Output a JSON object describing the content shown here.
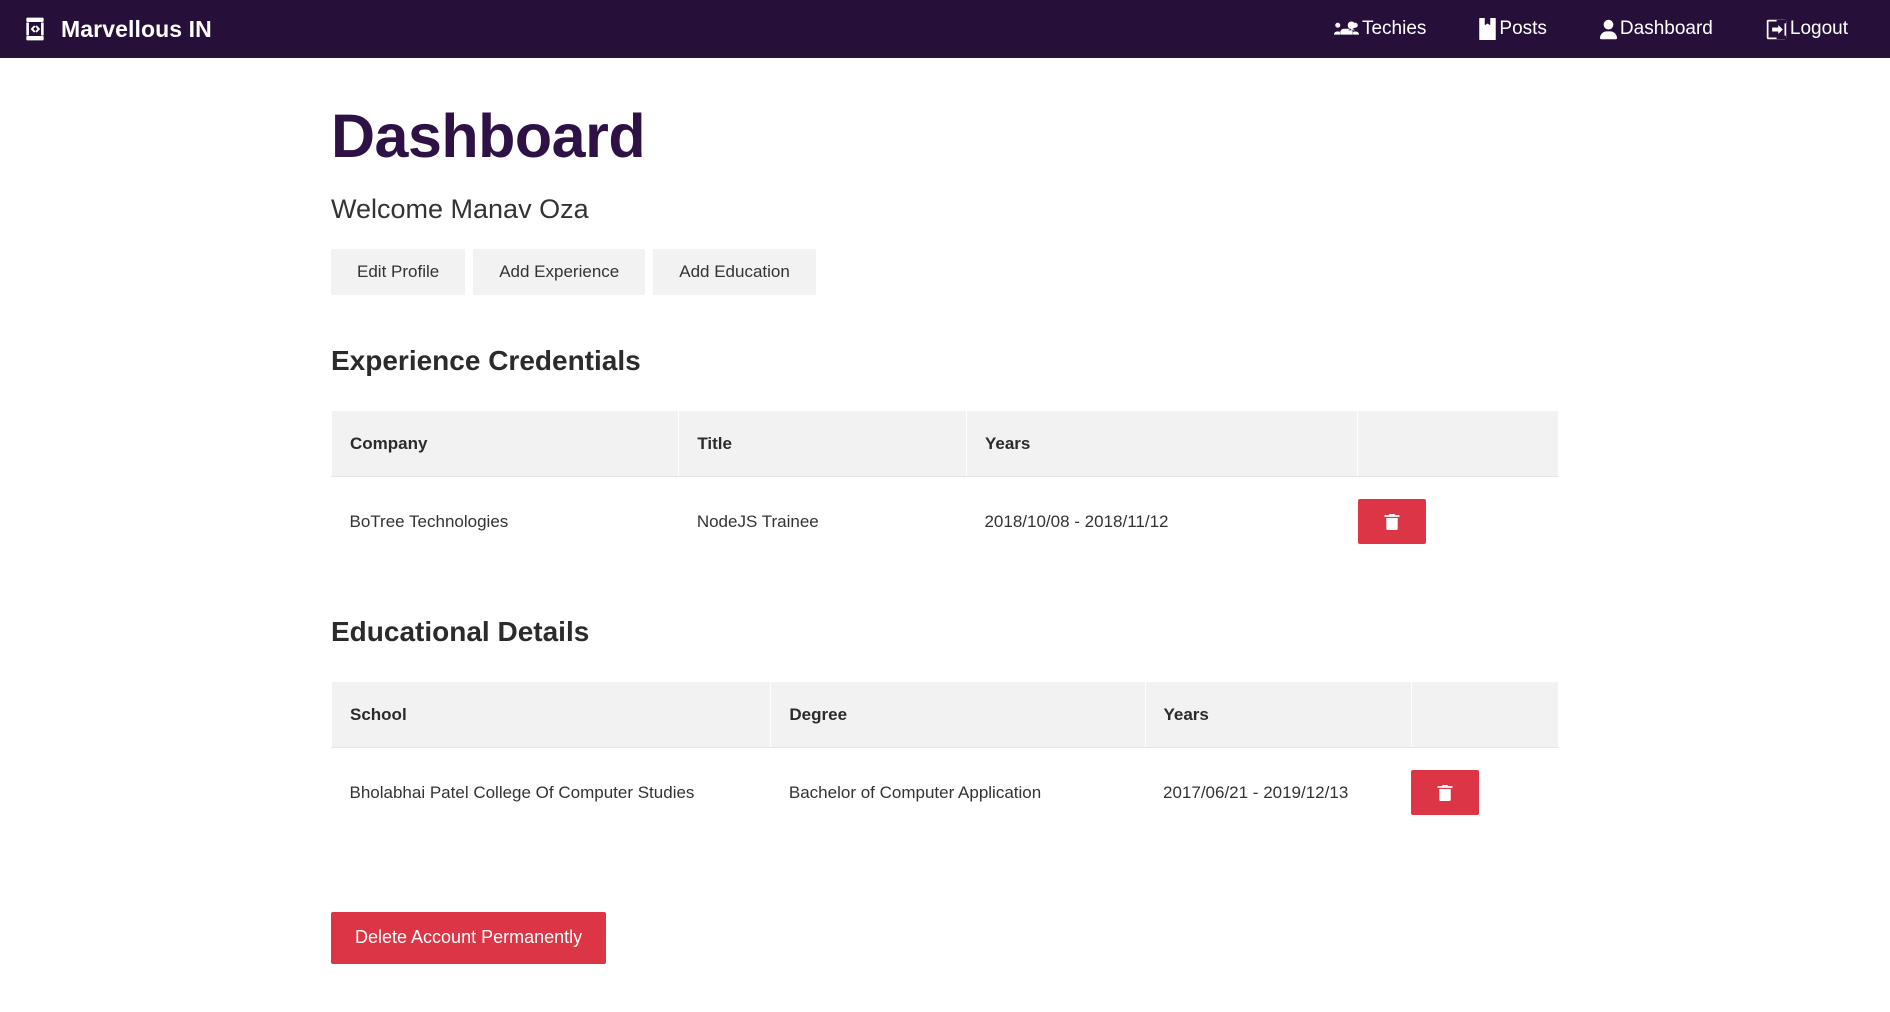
{
  "navbar": {
    "brand": {
      "label": "Marvellous IN",
      "icon": "code-laptop-icon"
    },
    "links": [
      {
        "label": "Techies",
        "icon": "users-icon"
      },
      {
        "label": "Posts",
        "icon": "book-bookmark-icon"
      },
      {
        "label": "Dashboard",
        "icon": "user-icon"
      },
      {
        "label": "Logout",
        "icon": "sign-out-icon"
      }
    ],
    "background": "#26103a",
    "text_color": "#ffffff"
  },
  "main": {
    "title": "Dashboard",
    "welcome": "Welcome Manav Oza",
    "title_color": "#2e1145",
    "actions": [
      {
        "label": "Edit Profile"
      },
      {
        "label": "Add Experience"
      },
      {
        "label": "Add Education"
      }
    ],
    "experience": {
      "heading": "Experience Credentials",
      "columns": [
        "Company",
        "Title",
        "Years",
        ""
      ],
      "rows": [
        {
          "company": "BoTree Technologies",
          "title": "NodeJS Trainee",
          "years": "2018/10/08 - 2018/11/12",
          "delete_icon": "trash-icon"
        }
      ]
    },
    "education": {
      "heading": "Educational Details",
      "columns": [
        "School",
        "Degree",
        "Years",
        ""
      ],
      "rows": [
        {
          "school": "Bholabhai Patel College Of Computer Studies",
          "degree": "Bachelor of Computer Application",
          "years": "2017/06/21 - 2019/12/13",
          "delete_icon": "trash-icon"
        }
      ]
    },
    "delete_account": {
      "label": "Delete Account Permanently",
      "color": "#dc3545"
    }
  }
}
